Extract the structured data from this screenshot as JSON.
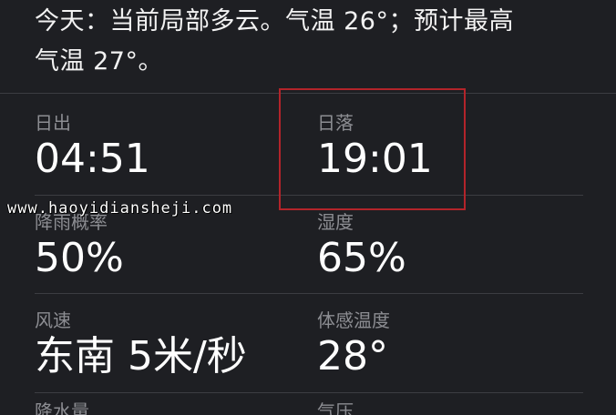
{
  "summary": {
    "line1": "今天：当前局部多云。气温 26°；预计最高",
    "line2": "气温 27°。"
  },
  "details": [
    {
      "label": "日出",
      "value": "04:51"
    },
    {
      "label": "日落",
      "value": "19:01"
    },
    {
      "label": "降雨概率",
      "value": "50%"
    },
    {
      "label": "湿度",
      "value": "65%"
    },
    {
      "label": "风速",
      "value": "东南 5米/秒"
    },
    {
      "label": "体感温度",
      "value": "28°"
    },
    {
      "label": "降水量",
      "value": ""
    },
    {
      "label": "气压",
      "value": ""
    }
  ],
  "watermark": "www.haoyidiansheji.com",
  "colors": {
    "background": "#1e1f23",
    "label": "#8c8d92",
    "divider": "#3c3d42",
    "highlight_border": "#b3242a"
  }
}
